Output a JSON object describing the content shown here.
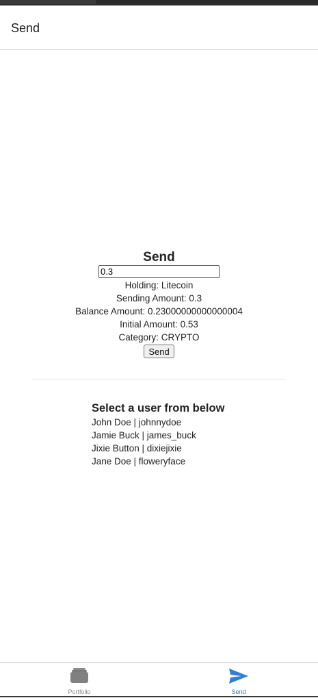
{
  "header": {
    "title": "Send"
  },
  "send_panel": {
    "title": "Send",
    "amount_value": "0.3",
    "holding": "Holding: Litecoin",
    "sending_amount": "Sending Amount: 0.3",
    "balance_amount": "Balance Amount: 0.23000000000000004",
    "initial_amount": "Initial Amount: 0.53",
    "category": "Category: CRYPTO",
    "send_label": "Send"
  },
  "users": {
    "heading": "Select a user from below",
    "items": [
      {
        "label": "John Doe | johnnydoe"
      },
      {
        "label": "Jamie Buck | james_buck"
      },
      {
        "label": "Jixie Button | dixiejixie"
      },
      {
        "label": "Jane Doe | floweryface"
      }
    ]
  },
  "tabbar": {
    "tabs": [
      {
        "label": "Portfolio",
        "icon": "wallet-icon",
        "active": false
      },
      {
        "label": "Send",
        "icon": "paper-plane-icon",
        "active": true
      }
    ]
  },
  "colors": {
    "accent": "#2f80d1",
    "inactive": "#888888"
  }
}
